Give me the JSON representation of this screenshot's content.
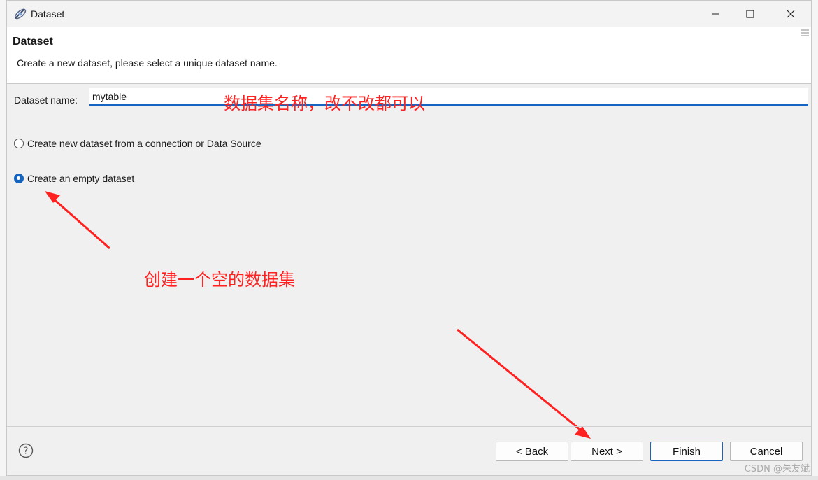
{
  "window": {
    "title": "Dataset"
  },
  "header": {
    "title": "Dataset",
    "description": "Create a new dataset, please select a unique dataset name."
  },
  "form": {
    "name_label": "Dataset name:",
    "name_value": "mytable"
  },
  "options": [
    {
      "label": "Create new dataset from a connection or Data Source",
      "selected": false
    },
    {
      "label": "Create an empty dataset",
      "selected": true
    }
  ],
  "annotations": {
    "name_note": "数据集名称，改不改都可以",
    "empty_note": "创建一个空的数据集"
  },
  "buttons": {
    "back": "< Back",
    "next": "Next >",
    "finish": "Finish",
    "cancel": "Cancel"
  },
  "watermark": "CSDN @朱友斌",
  "colors": {
    "accent": "#1565c0",
    "annotation": "#ff2020"
  }
}
